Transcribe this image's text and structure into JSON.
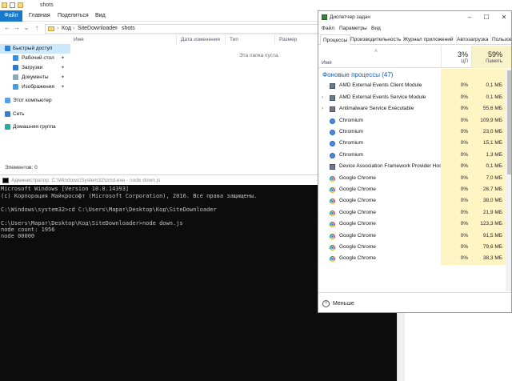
{
  "explorer": {
    "title": "shots",
    "tabs": [
      "Файл",
      "Главная",
      "Поделиться",
      "Вид"
    ],
    "breadcrumb": [
      "Код",
      "SiteDownloader",
      "shots"
    ],
    "nav": [
      {
        "label": "Быстрый доступ",
        "pinned": false
      },
      {
        "label": "Рабочий стол",
        "pinned": true
      },
      {
        "label": "Загрузки",
        "pinned": true
      },
      {
        "label": "Документы",
        "pinned": true
      },
      {
        "label": "Изображения",
        "pinned": true
      },
      {
        "label": "Этот компьютер",
        "pinned": false
      },
      {
        "label": "Сеть",
        "pinned": false
      },
      {
        "label": "Домашняя группа",
        "pinned": false
      }
    ],
    "columns": [
      "Имя",
      "Дата изменения",
      "Тип",
      "Размер"
    ],
    "empty_text": "Эта папка пуста.",
    "status": "Элементов: 0"
  },
  "console": {
    "title": "Администратор: C:\\Windows\\System32\\cmd.exe - node  down.js",
    "lines": [
      "Microsoft Windows [Version 10.0.14393]",
      "(c) Корпорация Майкрософт (Microsoft Corporation), 2016. Все права защищены.",
      "",
      "C:\\Windows\\system32>cd C:\\Users\\Марат\\Desktop\\Код\\SiteDownloader",
      "",
      "C:\\Users\\Марат\\Desktop\\Код\\SiteDownloader>node down.js",
      "node count: 1956",
      "node 00000"
    ]
  },
  "taskmgr": {
    "title": "Диспетчер задач",
    "menu": [
      "Файл",
      "Параметры",
      "Вид"
    ],
    "tabs": [
      "Процессы",
      "Производительность",
      "Журнал приложений",
      "Автозагрузка",
      "Пользовате"
    ],
    "active_tab": "Процессы",
    "header": {
      "name": "Имя",
      "cpu_pct": "3%",
      "cpu_label": "ЦП",
      "mem_pct": "59%",
      "mem_label": "Память"
    },
    "group": "Фоновые процессы (47)",
    "rows": [
      {
        "name": "AMD External Events Client Module",
        "cpu": "0%",
        "mem": "0,1 МБ",
        "icon": "service-icon",
        "expand": false
      },
      {
        "name": "AMD External Events Service Module",
        "cpu": "0%",
        "mem": "0,1 МБ",
        "icon": "service-icon",
        "expand": true
      },
      {
        "name": "Antimalware Service Executable",
        "cpu": "0%",
        "mem": "55,6 МБ",
        "icon": "service-icon",
        "expand": true
      },
      {
        "name": "Chromium",
        "cpu": "0%",
        "mem": "109,9 МБ",
        "icon": "chromium-icon",
        "expand": false
      },
      {
        "name": "Chromium",
        "cpu": "0%",
        "mem": "23,0 МБ",
        "icon": "chromium-icon",
        "expand": false
      },
      {
        "name": "Chromium",
        "cpu": "0%",
        "mem": "15,1 МБ",
        "icon": "chromium-icon",
        "expand": false
      },
      {
        "name": "Chromium",
        "cpu": "0%",
        "mem": "1,3 МБ",
        "icon": "chromium-icon",
        "expand": false
      },
      {
        "name": "Device Association Framework Provider Host",
        "cpu": "0%",
        "mem": "0,1 МБ",
        "icon": "service-icon",
        "expand": false
      },
      {
        "name": "Google Chrome",
        "cpu": "0%",
        "mem": "7,0 МБ",
        "icon": "chrome-icon",
        "expand": false
      },
      {
        "name": "Google Chrome",
        "cpu": "0%",
        "mem": "26,7 МБ",
        "icon": "chrome-icon",
        "expand": false
      },
      {
        "name": "Google Chrome",
        "cpu": "0%",
        "mem": "38,0 МБ",
        "icon": "chrome-icon",
        "expand": false
      },
      {
        "name": "Google Chrome",
        "cpu": "0%",
        "mem": "21,9 МБ",
        "icon": "chrome-icon",
        "expand": false
      },
      {
        "name": "Google Chrome",
        "cpu": "0%",
        "mem": "123,3 МБ",
        "icon": "chrome-icon",
        "expand": false
      },
      {
        "name": "Google Chrome",
        "cpu": "0%",
        "mem": "91,5 МБ",
        "icon": "chrome-icon",
        "expand": false
      },
      {
        "name": "Google Chrome",
        "cpu": "0%",
        "mem": "79,6 МБ",
        "icon": "chrome-icon",
        "expand": false
      },
      {
        "name": "Google Chrome",
        "cpu": "0%",
        "mem": "38,3 МБ",
        "icon": "chrome-icon",
        "expand": false
      }
    ],
    "footer": "Меньше"
  }
}
